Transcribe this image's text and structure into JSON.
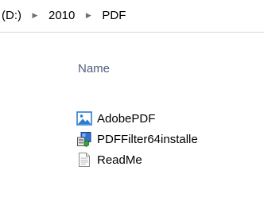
{
  "breadcrumb": {
    "items": [
      "(D:)",
      "2010",
      "PDF"
    ],
    "separator": "▶"
  },
  "list": {
    "column_header": "Name",
    "files": [
      {
        "name": "AdobePDF",
        "icon": "image-file-icon"
      },
      {
        "name": "PDFFilter64installe",
        "icon": "installer-icon"
      },
      {
        "name": "ReadMe",
        "icon": "text-document-icon"
      }
    ]
  },
  "colors": {
    "header_text": "#4c607a",
    "separator": "#707070",
    "image_icon_blue": "#2b7cd3"
  }
}
